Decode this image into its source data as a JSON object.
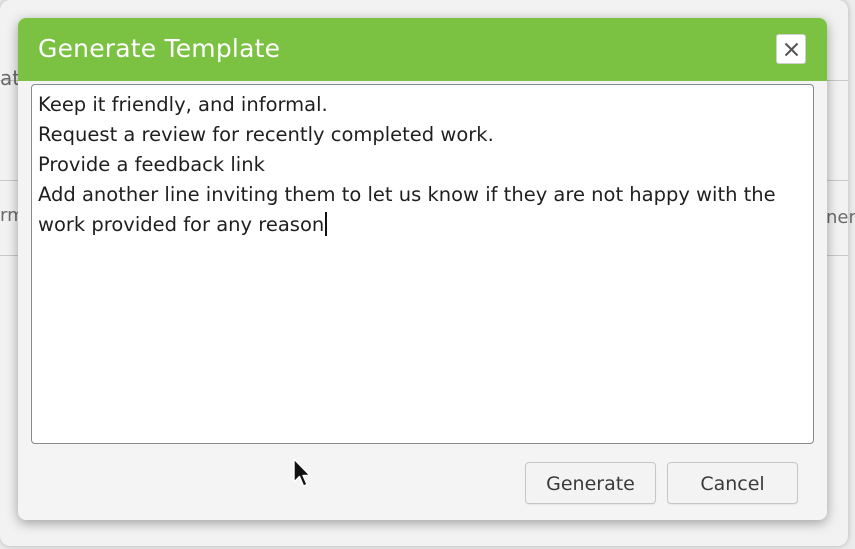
{
  "background": {
    "left_fragment_1": "at",
    "left_fragment_2": "rm",
    "right_fragment": "ner"
  },
  "dialog": {
    "title": "Generate Template",
    "close_icon": "close-icon",
    "header_color": "#7cc242",
    "editor": {
      "lines": [
        "Keep it friendly, and informal.",
        "Request a review for recently completed work.",
        "Provide a feedback link",
        "Add another line inviting them to let us know if they are not happy with the",
        "work provided for any reason"
      ]
    },
    "buttons": {
      "generate_label": "Generate",
      "cancel_label": "Cancel"
    }
  }
}
